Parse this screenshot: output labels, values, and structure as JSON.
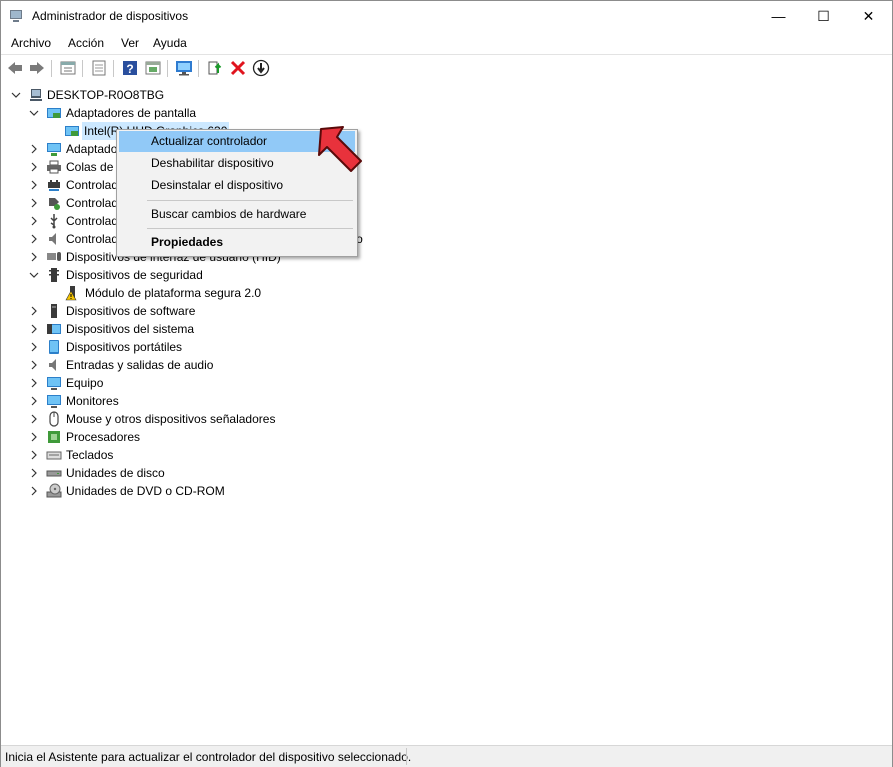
{
  "window": {
    "title": "Administrador de dispositivos",
    "minimize": "—",
    "maximize": "☐",
    "close": "✕"
  },
  "menubar": [
    "Archivo",
    "Acción",
    "Ver",
    "Ayuda"
  ],
  "toolbar": {
    "icons": [
      "back-icon",
      "forward-icon",
      "properties-view-icon",
      "list-view-icon",
      "help-icon",
      "device-view-icon",
      "monitor-scan-icon",
      "update-driver-icon",
      "uninstall-icon",
      "disable-icon"
    ]
  },
  "tree": {
    "root": "DESKTOP-R0O8TBG",
    "display_adapters": "Adaptadores de pantalla",
    "display_child": "Intel(R) UHD Graphics 630",
    "items": [
      "Adaptadores de red",
      "Colas de impresión",
      "Controladoras ATA/ATAPI IDE",
      "Controladoras de almacenamiento",
      "Controladoras de bus serie universal",
      "Controladoras de sonido y vídeo y dispositivos de juego",
      "Dispositivos de interfaz de usuario (HID)"
    ],
    "security": "Dispositivos de seguridad",
    "security_child": "Módulo de plataforma segura 2.0",
    "items_after": [
      "Dispositivos de software",
      "Dispositivos del sistema",
      "Dispositivos portátiles",
      "Entradas y salidas de audio",
      "Equipo",
      "Monitores",
      "Mouse y otros dispositivos señaladores",
      "Procesadores",
      "Teclados",
      "Unidades de disco",
      "Unidades de DVD o CD-ROM"
    ]
  },
  "context_menu": {
    "update": "Actualizar controlador",
    "disable": "Deshabilitar dispositivo",
    "uninstall": "Desinstalar el dispositivo",
    "scan": "Buscar cambios de hardware",
    "properties": "Propiedades"
  },
  "statusbar": {
    "text": "Inicia el Asistente para actualizar el controlador del dispositivo seleccionado."
  },
  "colors": {
    "highlight": "#91c9f7",
    "selection": "#cce8ff",
    "arrow": "#e8323c"
  }
}
